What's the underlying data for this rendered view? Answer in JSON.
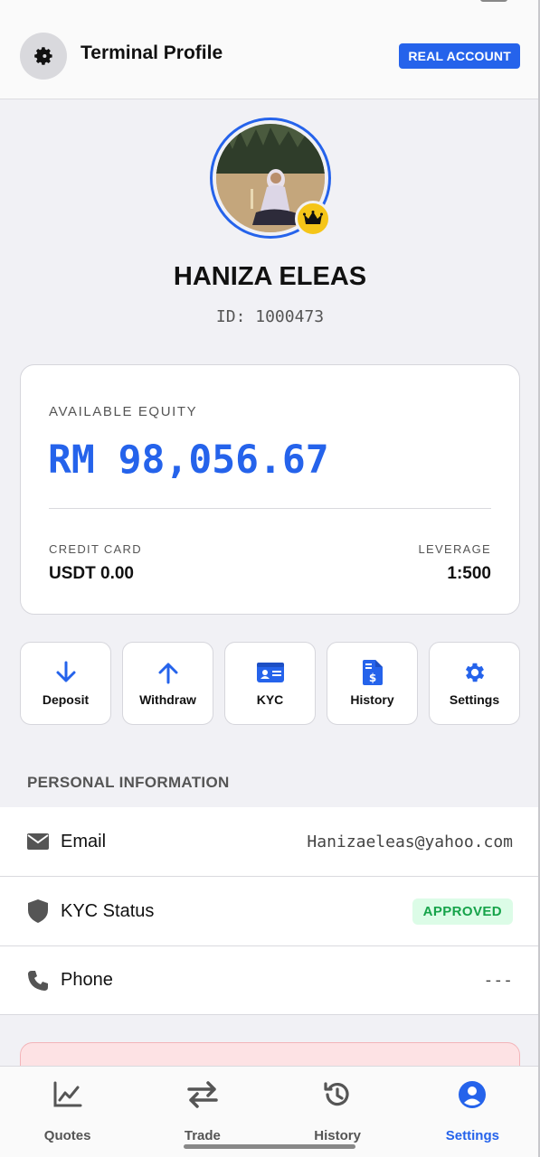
{
  "header": {
    "title": "Terminal Profile",
    "account_badge": "REAL ACCOUNT"
  },
  "profile": {
    "name": "HANIZA ELEAS",
    "id_text": "ID: 1000473"
  },
  "equity_card": {
    "label": "AVAILABLE EQUITY",
    "value": "RM 98,056.67",
    "credit_label": "CREDIT CARD",
    "credit_value": "USDT 0.00",
    "leverage_label": "LEVERAGE",
    "leverage_value": "1:500"
  },
  "actions": [
    {
      "label": "Deposit",
      "icon": "arrow-down-icon"
    },
    {
      "label": "Withdraw",
      "icon": "arrow-up-icon"
    },
    {
      "label": "KYC",
      "icon": "id-card-icon"
    },
    {
      "label": "History",
      "icon": "invoice-icon"
    },
    {
      "label": "Settings",
      "icon": "gear-icon"
    }
  ],
  "personal_info": {
    "title": "PERSONAL INFORMATION",
    "rows": [
      {
        "label": "Email",
        "value": "Hanizaeleas@yahoo.com",
        "icon": "envelope-icon"
      },
      {
        "label": "KYC Status",
        "value": "APPROVED",
        "icon": "shield-icon"
      },
      {
        "label": "Phone",
        "value": "---",
        "icon": "phone-icon"
      }
    ]
  },
  "bottom_nav": [
    {
      "label": "Quotes",
      "icon": "chart-line-icon"
    },
    {
      "label": "Trade",
      "icon": "swap-arrows-icon"
    },
    {
      "label": "History",
      "icon": "history-clock-icon"
    },
    {
      "label": "Settings",
      "icon": "user-circle-icon",
      "active": true
    }
  ],
  "colors": {
    "accent": "#2563eb",
    "approved_bg": "#dcfce7",
    "approved_text": "#16a34a",
    "crown": "#f5c518"
  }
}
